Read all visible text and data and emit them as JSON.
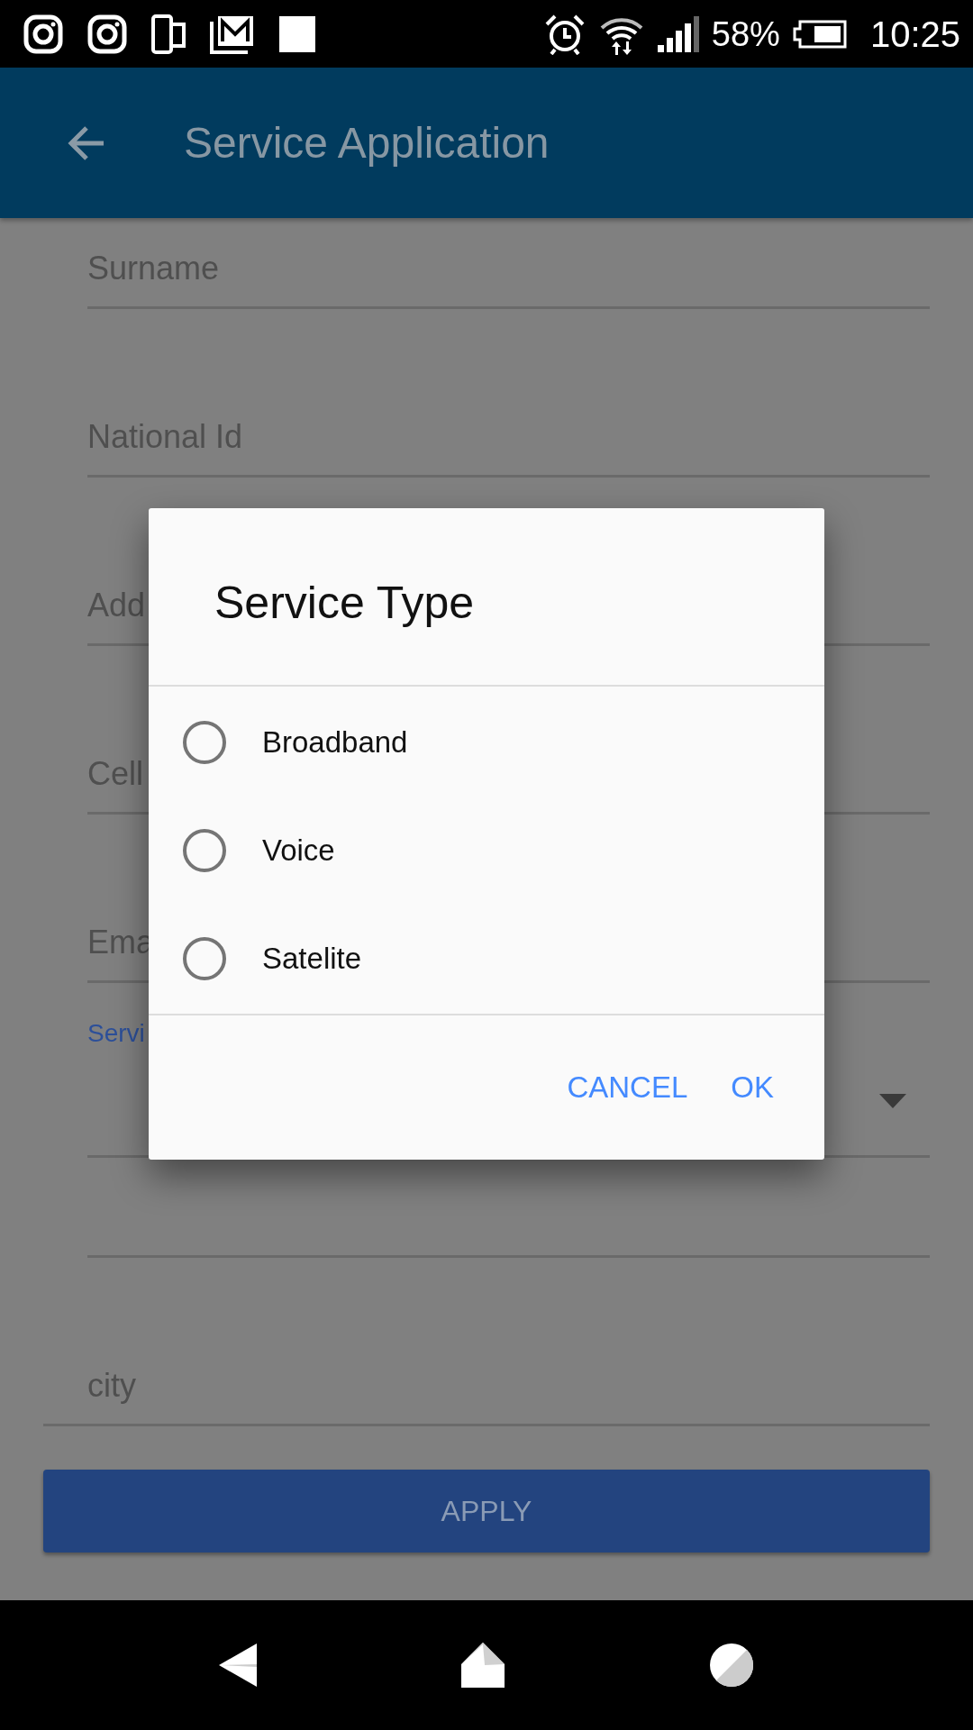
{
  "status_bar": {
    "battery": "58%",
    "time": "10:25"
  },
  "app_bar": {
    "title": "Service Application"
  },
  "form": {
    "fields": [
      {
        "kind": "text",
        "label": "Surname"
      },
      {
        "kind": "text",
        "label": "National Id"
      },
      {
        "kind": "text",
        "label": "Add"
      },
      {
        "kind": "text",
        "label": "Cell"
      },
      {
        "kind": "text",
        "label": "Ema"
      },
      {
        "kind": "select",
        "label": "Servi"
      },
      {
        "kind": "blank"
      },
      {
        "kind": "text",
        "label": "city"
      }
    ],
    "submit": "APPLY"
  },
  "dialog": {
    "title": "Service Type",
    "options": [
      {
        "label": "Broadband",
        "selected": false
      },
      {
        "label": "Voice",
        "selected": false
      },
      {
        "label": "Satelite",
        "selected": false
      }
    ],
    "buttons": [
      "CANCEL",
      "OK"
    ]
  }
}
